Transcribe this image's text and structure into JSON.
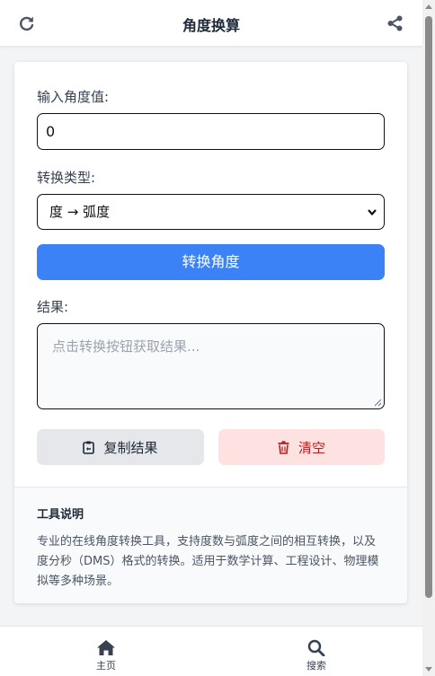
{
  "header": {
    "title": "角度换算",
    "refresh_icon": "refresh-icon",
    "share_icon": "share-icon"
  },
  "form": {
    "angle_label": "输入角度值:",
    "angle_value": "0",
    "type_label": "转换类型:",
    "type_selected": "度 → 弧度",
    "convert_button": "转换角度",
    "result_label": "结果:",
    "result_placeholder": "点击转换按钮获取结果...",
    "copy_button": "复制结果",
    "clear_button": "清空"
  },
  "info": {
    "heading": "工具说明",
    "description": "专业的在线角度转换工具，支持度数与弧度之间的相互转换，以及度分秒（DMS）格式的转换。适用于数学计算、工程设计、物理模拟等多种场景。"
  },
  "nav": {
    "home": "主页",
    "search": "搜索"
  },
  "colors": {
    "primary": "#3b82f6",
    "danger_bg": "#fee2e2",
    "danger_text": "#b91c1c"
  }
}
